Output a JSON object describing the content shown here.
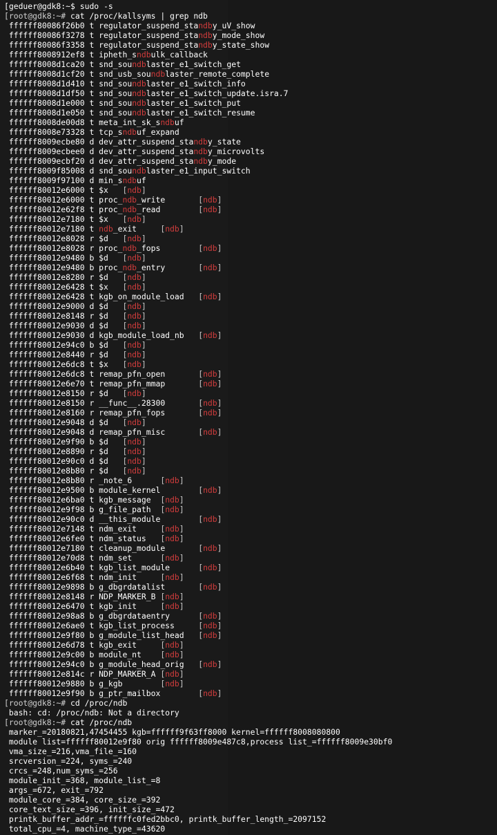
{
  "terminal": {
    "top_partial": "[geduer@gdk8:~$ sudo -s",
    "prompt_root": "[root@gdk8:~# ",
    "cmd_kallsyms": "cat /proc/kallsyms | grep ndb",
    "cmd_cd": "cd /proc/ndb",
    "cmd_cat": "cat /proc/ndb",
    "cd_error": "bash: cd: /proc/ndb: Not a directory",
    "highlight": "ndb"
  },
  "symbols_plain": [
    {
      "addr": "ffffff80086f26b0",
      "type": "t",
      "pre": "regulator_suspend_sta",
      "hl": "ndb",
      "post": "y_uV_show"
    },
    {
      "addr": "ffffff80086f3278",
      "type": "t",
      "pre": "regulator_suspend_sta",
      "hl": "ndb",
      "post": "y_mode_show"
    },
    {
      "addr": "ffffff80086f3358",
      "type": "t",
      "pre": "regulator_suspend_sta",
      "hl": "ndb",
      "post": "y_state_show"
    },
    {
      "addr": "ffffff8008912ef8",
      "type": "t",
      "pre": "ipheth_s",
      "hl": "ndb",
      "post": "ulk_callback"
    },
    {
      "addr": "ffffff8008d1ca20",
      "type": "t",
      "pre": "snd_sou",
      "hl": "ndb",
      "post": "laster_e1_switch_get"
    },
    {
      "addr": "ffffff8008d1cf20",
      "type": "t",
      "pre": "snd_usb_sou",
      "hl": "ndb",
      "post": "laster_remote_complete"
    },
    {
      "addr": "ffffff8008d1d410",
      "type": "t",
      "pre": "snd_sou",
      "hl": "ndb",
      "post": "laster_e1_switch_info"
    },
    {
      "addr": "ffffff8008d1df50",
      "type": "t",
      "pre": "snd_sou",
      "hl": "ndb",
      "post": "laster_e1_switch_update.isra.7"
    },
    {
      "addr": "ffffff8008d1e000",
      "type": "t",
      "pre": "snd_sou",
      "hl": "ndb",
      "post": "laster_e1_switch_put"
    },
    {
      "addr": "ffffff8008d1e050",
      "type": "t",
      "pre": "snd_sou",
      "hl": "ndb",
      "post": "laster_e1_switch_resume"
    },
    {
      "addr": "ffffff8008de00d8",
      "type": "t",
      "pre": "meta_int_sk_s",
      "hl": "ndb",
      "post": "uf"
    },
    {
      "addr": "ffffff8008e73328",
      "type": "t",
      "pre": "tcp_s",
      "hl": "ndb",
      "post": "uf_expand"
    },
    {
      "addr": "ffffff8009ecbe80",
      "type": "d",
      "pre": "dev_attr_suspend_sta",
      "hl": "ndb",
      "post": "y_state"
    },
    {
      "addr": "ffffff8009ecbee0",
      "type": "d",
      "pre": "dev_attr_suspend_sta",
      "hl": "ndb",
      "post": "y_microvolts"
    },
    {
      "addr": "ffffff8009ecbf20",
      "type": "d",
      "pre": "dev_attr_suspend_sta",
      "hl": "ndb",
      "post": "y_mode"
    },
    {
      "addr": "ffffff8009f85008",
      "type": "d",
      "pre": "snd_sou",
      "hl": "ndb",
      "post": "laster_e1_input_switch"
    },
    {
      "addr": "ffffff8009f97100",
      "type": "d",
      "pre": "min_s",
      "hl": "ndb",
      "post": "uf"
    }
  ],
  "symbols_module": [
    {
      "addr": "ffffff80012e6000",
      "type": "t",
      "name": "$x",
      "pad": "   "
    },
    {
      "addr": "ffffff80012e6000",
      "type": "t",
      "name": "proc_ndb_write",
      "pad": "       "
    },
    {
      "addr": "ffffff80012e62f8",
      "type": "t",
      "name": "proc_ndb_read",
      "pad": "        "
    },
    {
      "addr": "ffffff80012e7180",
      "type": "t",
      "name": "$x",
      "pad": "   "
    },
    {
      "addr": "ffffff80012e7180",
      "type": "t",
      "name": "ndb_exit",
      "pad": "     "
    },
    {
      "addr": "ffffff80012e8028",
      "type": "r",
      "name": "$d",
      "pad": "   "
    },
    {
      "addr": "ffffff80012e8028",
      "type": "r",
      "name": "proc_ndb_fops",
      "pad": "        "
    },
    {
      "addr": "ffffff80012e9480",
      "type": "b",
      "name": "$d",
      "pad": "   "
    },
    {
      "addr": "ffffff80012e9480",
      "type": "b",
      "name": "proc_ndb_entry",
      "pad": "       "
    },
    {
      "addr": "ffffff80012e8280",
      "type": "r",
      "name": "$d",
      "pad": "   "
    },
    {
      "addr": "ffffff80012e6428",
      "type": "t",
      "name": "$x",
      "pad": "   "
    },
    {
      "addr": "ffffff80012e6428",
      "type": "t",
      "name": "kgb_on_module_load",
      "pad": "   "
    },
    {
      "addr": "ffffff80012e9000",
      "type": "d",
      "name": "$d",
      "pad": "   "
    },
    {
      "addr": "ffffff80012e8148",
      "type": "r",
      "name": "$d",
      "pad": "   "
    },
    {
      "addr": "ffffff80012e9030",
      "type": "d",
      "name": "$d",
      "pad": "   "
    },
    {
      "addr": "ffffff80012e9030",
      "type": "d",
      "name": "kgb_module_load_nb",
      "pad": "   "
    },
    {
      "addr": "ffffff80012e94c0",
      "type": "b",
      "name": "$d",
      "pad": "   "
    },
    {
      "addr": "ffffff80012e8440",
      "type": "r",
      "name": "$d",
      "pad": "   "
    },
    {
      "addr": "ffffff80012e6dc8",
      "type": "t",
      "name": "$x",
      "pad": "   "
    },
    {
      "addr": "ffffff80012e6dc8",
      "type": "t",
      "name": "remap_pfn_open",
      "pad": "       "
    },
    {
      "addr": "ffffff80012e6e70",
      "type": "t",
      "name": "remap_pfn_mmap",
      "pad": "       "
    },
    {
      "addr": "ffffff80012e8150",
      "type": "r",
      "name": "$d",
      "pad": "   "
    },
    {
      "addr": "ffffff80012e8150",
      "type": "r",
      "name": "__func__.28300",
      "pad": "       "
    },
    {
      "addr": "ffffff80012e8160",
      "type": "r",
      "name": "remap_pfn_fops",
      "pad": "       "
    },
    {
      "addr": "ffffff80012e9048",
      "type": "d",
      "name": "$d",
      "pad": "   "
    },
    {
      "addr": "ffffff80012e9048",
      "type": "d",
      "name": "remap_pfn_misc",
      "pad": "       "
    },
    {
      "addr": "ffffff80012e9f90",
      "type": "b",
      "name": "$d",
      "pad": "   "
    },
    {
      "addr": "ffffff80012e8890",
      "type": "r",
      "name": "$d",
      "pad": "   "
    },
    {
      "addr": "ffffff80012e90c0",
      "type": "d",
      "name": "$d",
      "pad": "   "
    },
    {
      "addr": "ffffff80012e8b80",
      "type": "r",
      "name": "$d",
      "pad": "   "
    },
    {
      "addr": "ffffff80012e8b80",
      "type": "r",
      "name": "_note_6",
      "pad": "      "
    },
    {
      "addr": "ffffff80012e9500",
      "type": "b",
      "name": "module_kernel",
      "pad": "        "
    },
    {
      "addr": "ffffff80012e6ba0",
      "type": "t",
      "name": "kgb_message",
      "pad": "  "
    },
    {
      "addr": "ffffff80012e9f98",
      "type": "b",
      "name": "g_file_path",
      "pad": "  "
    },
    {
      "addr": "ffffff80012e90c0",
      "type": "d",
      "name": "__this_module",
      "pad": "        "
    },
    {
      "addr": "ffffff80012e7148",
      "type": "t",
      "name": "ndm_exit",
      "pad": "     "
    },
    {
      "addr": "ffffff80012e6fe0",
      "type": "t",
      "name": "ndm_status",
      "pad": "   "
    },
    {
      "addr": "ffffff80012e7180",
      "type": "t",
      "name": "cleanup_module",
      "pad": "       "
    },
    {
      "addr": "ffffff80012e70d8",
      "type": "t",
      "name": "ndm_set",
      "pad": "      "
    },
    {
      "addr": "ffffff80012e6b40",
      "type": "t",
      "name": "kgb_list_module",
      "pad": "      "
    },
    {
      "addr": "ffffff80012e6f68",
      "type": "t",
      "name": "ndm_init",
      "pad": "     "
    },
    {
      "addr": "ffffff80012e9898",
      "type": "b",
      "name": "g_dbgrdatalist",
      "pad": "       "
    },
    {
      "addr": "ffffff80012e8148",
      "type": "r",
      "name": "NDP_MARKER_B",
      "pad": " "
    },
    {
      "addr": "ffffff80012e6470",
      "type": "t",
      "name": "kgb_init",
      "pad": "     "
    },
    {
      "addr": "ffffff80012e98a8",
      "type": "b",
      "name": "g_dbgrdataentry",
      "pad": "      "
    },
    {
      "addr": "ffffff80012e6ae0",
      "type": "t",
      "name": "kgb_list_process",
      "pad": "     "
    },
    {
      "addr": "ffffff80012e9f80",
      "type": "b",
      "name": "g_module_list_head",
      "pad": "   "
    },
    {
      "addr": "ffffff80012e6d78",
      "type": "t",
      "name": "kgb_exit",
      "pad": "     "
    },
    {
      "addr": "ffffff80012e9c00",
      "type": "b",
      "name": "module_nt",
      "pad": "    "
    },
    {
      "addr": "ffffff80012e94c0",
      "type": "b",
      "name": "g_module_head_orig",
      "pad": "   "
    },
    {
      "addr": "ffffff80012e814c",
      "type": "r",
      "name": "NDP_MARKER_A",
      "pad": " "
    },
    {
      "addr": "ffffff80012e9880",
      "type": "b",
      "name": "g_kgb",
      "pad": "        "
    },
    {
      "addr": "ffffff80012e9f90",
      "type": "b",
      "name": "g_ptr_mailbox",
      "pad": "        "
    }
  ],
  "ndb_output": [
    "marker_=20180821,47454455 kgb=ffffff9f63ff8000 kernel=ffffff8008080800",
    "module list=ffffff80012e9f80 orig ffffff8009e487c8,process list_=ffffff8009e30bf0",
    "vma_size_=216,vma_file_=160",
    "srcversion_=224, syms_=240",
    "crcs_=248,num_syms_=256",
    "module_init_=368, module_list_=8",
    "args_=672, exit_=792",
    "module_core_=384, core_size_=392",
    "core_text_size_=396, init_size_=472",
    "printk_buffer_addr_=ffffffc0fed2bbc0, printk_buffer_length_=2097152",
    "total_cpu_=4, machine_type_=43620"
  ]
}
